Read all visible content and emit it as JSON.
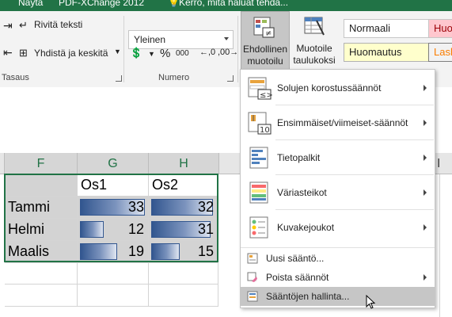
{
  "titlebar": {
    "tab1": "Näytä",
    "tab2": "PDF-XChange 2012",
    "tab3": "Kerro, mitä haluat tehdä..."
  },
  "ribbon": {
    "wrap_text": "Rivitä teksti",
    "merge_center": "Yhdistä ja keskitä",
    "alignment_group": "Tasaus",
    "number_format": "Yleinen",
    "percent_symbol": "%",
    "thousands_symbol": "000",
    "number_group": "Numero",
    "conditional_formatting_line1": "Ehdollinen",
    "conditional_formatting_line2": "muotoilu",
    "format_as_table_line1": "Muotoile",
    "format_as_table_line2": "taulukoksi",
    "style_normal": "Normaali",
    "style_bad": "Huo",
    "style_note": "Huomautus",
    "style_calc": "Lask"
  },
  "columns": [
    "F",
    "G",
    "H",
    "I"
  ],
  "table": {
    "headers": [
      "Os1",
      "Os2"
    ],
    "rows": [
      {
        "label": "Tammi",
        "os1": 33,
        "os2": 32
      },
      {
        "label": "Helmi",
        "os1": 12,
        "os2": 31
      },
      {
        "label": "Maalis",
        "os1": 19,
        "os2": 15
      }
    ],
    "bar_color": "#5b7bb0"
  },
  "menu": {
    "items": [
      {
        "label": "Solujen korostussäännöt",
        "icon": "highlight-cells-icon"
      },
      {
        "label": "Ensimmäiset/viimeiset-säännöt",
        "icon": "top-bottom-icon"
      },
      {
        "label": "Tietopalkit",
        "icon": "data-bars-icon"
      },
      {
        "label": "Väriasteikot",
        "icon": "color-scales-icon"
      },
      {
        "label": "Kuvakejoukot",
        "icon": "icon-sets-icon"
      }
    ],
    "new_rule": "Uusi sääntö...",
    "clear_rules": "Poista säännöt",
    "manage_rules": "Sääntöjen hallinta..."
  }
}
